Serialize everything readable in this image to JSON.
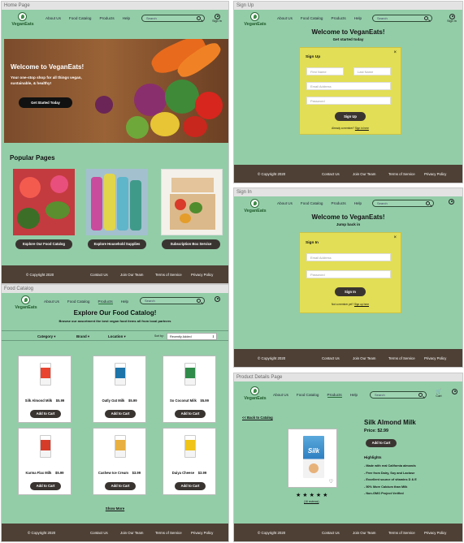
{
  "brand": "VeganEats",
  "nav": {
    "about": "About Us",
    "catalog": "Food Catalog",
    "products": "Products",
    "help": "Help",
    "search_placeholder": "Search",
    "signin": "Sign In",
    "cart": "Cart"
  },
  "footer": {
    "copyright": "© Copyright 2020",
    "contact": "Contact Us",
    "team": "Join Our Team",
    "terms": "Terms of Service",
    "privacy": "Privacy Policy"
  },
  "home": {
    "title": "Home Page",
    "hero_title": "Welcome to VeganEats!",
    "hero_sub": "Your one-stop shop for all things vegan, sustainable, & healthy!",
    "hero_button": "Get Started Today",
    "popular_title": "Popular Pages",
    "cards": [
      {
        "button": "Explore Our Food Catalog"
      },
      {
        "button": "Explore Household Supplies"
      },
      {
        "button": "Subscription Box Service"
      }
    ]
  },
  "signup": {
    "title": "Sign Up",
    "heading": "Welcome to VeganEats!",
    "sub": "Get started today",
    "modal_title": "Sign Up",
    "first_name": "First Name",
    "last_name": "Last Name",
    "email": "Email Address",
    "password": "Password",
    "button": "Sign Up",
    "member_text": "Already a member?",
    "member_link": "Sign in here"
  },
  "signin": {
    "title": "Sign In",
    "heading": "Welcome to VeganEats!",
    "sub": "Jump back in",
    "modal_title": "Sign In",
    "email": "Email Address",
    "password": "Password",
    "button": "Sign In",
    "new_text": "Not a member yet?",
    "new_link": "Sign up here"
  },
  "catalog": {
    "title": "Food Catalog",
    "heading": "Explore Our Food Catalog!",
    "sub": "Browse our assortment  the best vegan food items all from local partners",
    "filters": {
      "category": "Category",
      "brand": "Brand",
      "location": "Location",
      "sort_label": "Sort by:",
      "sort_value": "Recently Added"
    },
    "items": [
      {
        "name": "Silk Almond Milk",
        "price": "$5.99",
        "button": "Add to Cart",
        "color": "#e8442f"
      },
      {
        "name": "Oatly Oat Milk",
        "price": "$5.99",
        "button": "Add to Cart",
        "color": "#1c74a8"
      },
      {
        "name": "So Coconut Milk",
        "price": "$5.99",
        "button": "Add to Cart",
        "color": "#2f8b4a"
      },
      {
        "name": "Karma Flax Milk",
        "price": "$5.99",
        "button": "Add to Cart",
        "color": "#d63b2a"
      },
      {
        "name": "Cashew Ice Cream",
        "price": "$3.99",
        "button": "Add to Cart",
        "color": "#e8b040"
      },
      {
        "name": "Daiya Cheese",
        "price": "$3.99",
        "button": "Add to Cart",
        "color": "#f0c418"
      }
    ],
    "show_more": "Show More"
  },
  "product": {
    "title": "Product Details Page",
    "back": "<< Back to Catalog",
    "name": "Silk Almond Milk",
    "price": "Price: $2.99",
    "button": "Add to Cart",
    "highlights_title": "Highlights",
    "highlights": [
      "- Made with real California almonds",
      "- Free from Dairy, Soy and Lactose",
      "- Excellent source of vitamins D & E",
      "- 50% More Calcium than Milk",
      "- Non-GMO Project Verified"
    ],
    "rating": 5,
    "reviews": "(16 reviews)",
    "carton_label": "Silk"
  }
}
